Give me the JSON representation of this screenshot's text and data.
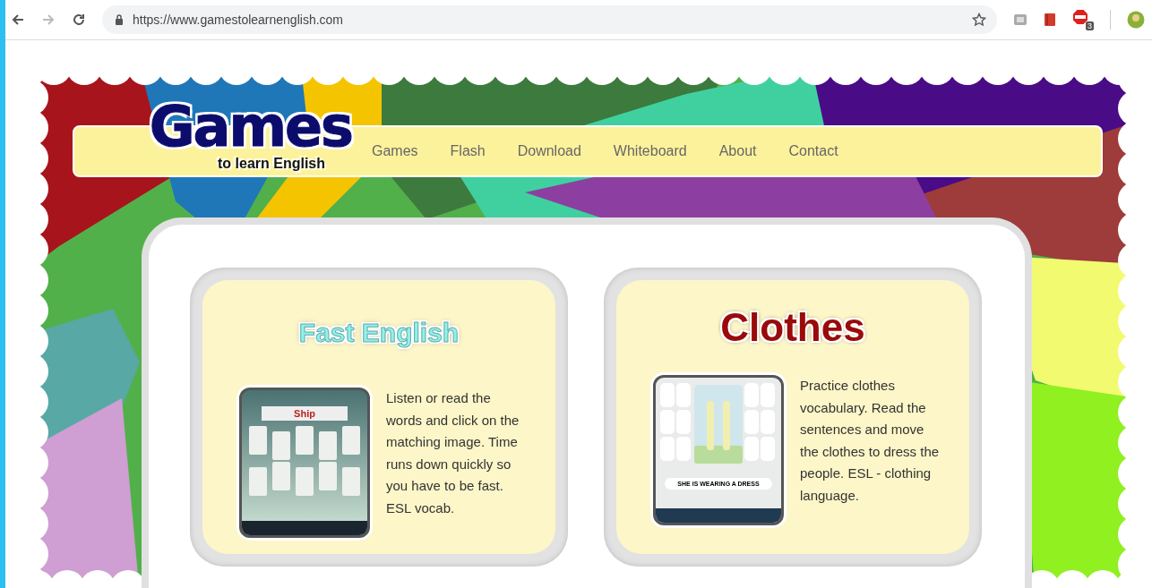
{
  "browser": {
    "url": "https://www.gamestolearnenglish.com",
    "extension_badge": "3"
  },
  "logo": {
    "title": "Games",
    "subtitle": "to learn English"
  },
  "nav": [
    {
      "label": "Games"
    },
    {
      "label": "Flash"
    },
    {
      "label": "Download"
    },
    {
      "label": "Whiteboard"
    },
    {
      "label": "About"
    },
    {
      "label": "Contact"
    }
  ],
  "games": [
    {
      "kind": "fast-english",
      "title": "Fast English",
      "screenshot_text": "Ship",
      "description": "Listen or read the words and click on the matching image. Time runs down quickly so you have to be fast. ESL vocab."
    },
    {
      "kind": "clothes",
      "title": "Clothes",
      "screenshot_text": "SHE IS WEARING A DRESS",
      "description": "Practice clothes vocabulary. Read the sentences and move the clothes to dress the people. ESL - clothing language."
    }
  ]
}
